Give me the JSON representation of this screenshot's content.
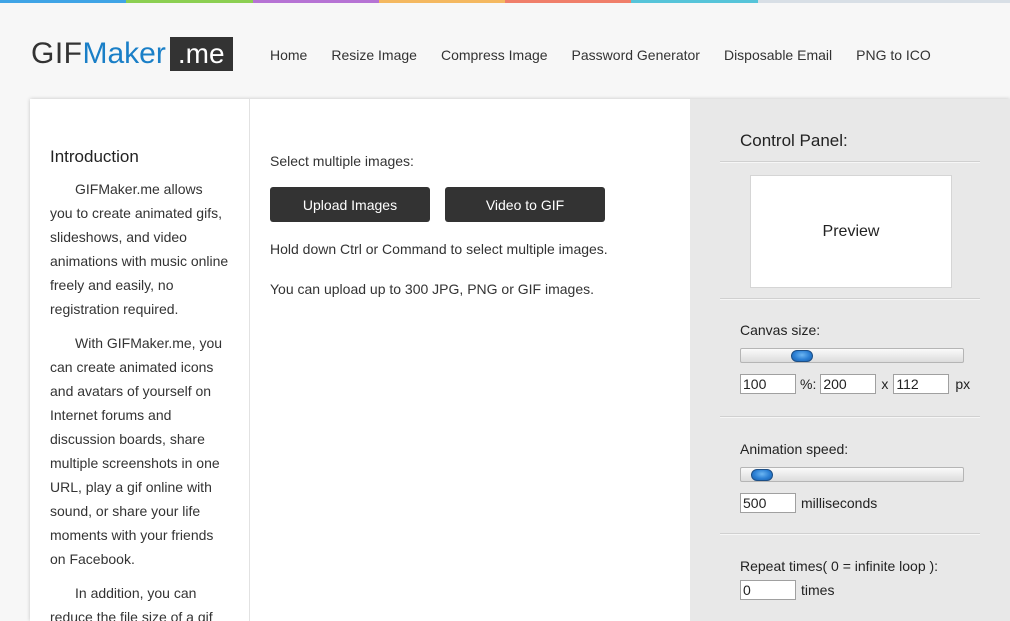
{
  "colors": {
    "rainbow": [
      "#3fa4e6",
      "#8ccf52",
      "#b673d4",
      "#f4b860",
      "#f07f6a",
      "#56c4d9",
      "#d8dfe6",
      "#d8dfe6"
    ],
    "logo_blue": "#1a7fc7",
    "button_dark": "#333333",
    "slider_handle": "#2b7fd4"
  },
  "logo": {
    "part1": "GIF",
    "part2": "Maker",
    "part3": ".me"
  },
  "nav": [
    "Home",
    "Resize Image",
    "Compress Image",
    "Password Generator",
    "Disposable Email",
    "PNG to ICO"
  ],
  "intro": {
    "title": "Introduction",
    "paragraphs": [
      "GIFMaker.me allows you to create animated gifs, slideshows, and video animations with music online freely and easily, no registration required.",
      "With GIFMaker.me, you can create animated icons and avatars of yourself on Internet forums and discussion boards, share multiple screenshots in one URL, play a gif online with sound, or share your life moments with your friends on Facebook.",
      "In addition, you can reduce the file size of a gif"
    ]
  },
  "upload": {
    "select_label": "Select multiple images:",
    "upload_button": "Upload Images",
    "video_button": "Video to GIF",
    "hint_ctrl": "Hold down Ctrl or Command to select multiple images.",
    "hint_limit": "You can upload up to 300 JPG, PNG or GIF images."
  },
  "control_panel": {
    "title": "Control Panel:",
    "preview_label": "Preview",
    "canvas": {
      "label": "Canvas size:",
      "slider_fraction": 0.25,
      "percent": "100",
      "percent_unit": "%:",
      "width": "200",
      "x_sep": "x",
      "height": "112",
      "px_unit": "px"
    },
    "speed": {
      "label": "Animation speed:",
      "slider_fraction": 0.05,
      "value": "500",
      "unit": "milliseconds"
    },
    "repeat": {
      "label": "Repeat times( 0 = infinite loop ):",
      "value": "0",
      "unit": "times"
    }
  }
}
